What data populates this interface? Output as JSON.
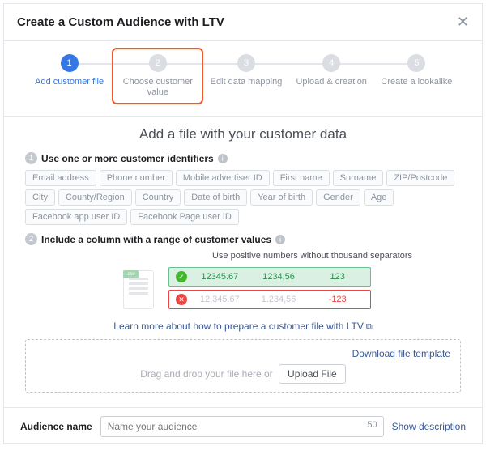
{
  "header": {
    "title": "Create a Custom Audience with LTV"
  },
  "steps": [
    {
      "num": "1",
      "label": "Add customer file"
    },
    {
      "num": "2",
      "label": "Choose customer value"
    },
    {
      "num": "3",
      "label": "Edit data mapping"
    },
    {
      "num": "4",
      "label": "Upload & creation"
    },
    {
      "num": "5",
      "label": "Create a lookalike"
    }
  ],
  "main": {
    "heading": "Add a file with your customer data",
    "sec1": {
      "title": "Use one or more customer identifiers"
    },
    "tags": [
      "Email address",
      "Phone number",
      "Mobile advertiser ID",
      "First name",
      "Surname",
      "ZIP/Postcode",
      "City",
      "County/Region",
      "Country",
      "Date of birth",
      "Year of birth",
      "Gender",
      "Age",
      "Facebook app user ID",
      "Facebook Page user ID"
    ],
    "sec2": {
      "title": "Include a column with a range of customer values"
    },
    "hint": "Use positive numbers without thousand separators",
    "good": [
      "12345.67",
      "1234,56",
      "123"
    ],
    "bad": [
      "12,345.67",
      "1.234,56",
      "-123"
    ],
    "learn": "Learn more about how to prepare a customer file with LTV",
    "drop": {
      "download": "Download file template",
      "text": "Drag and drop your file here or",
      "btn": "Upload File"
    }
  },
  "footer": {
    "label": "Audience name",
    "placeholder": "Name your audience",
    "count": "50",
    "show": "Show description"
  }
}
